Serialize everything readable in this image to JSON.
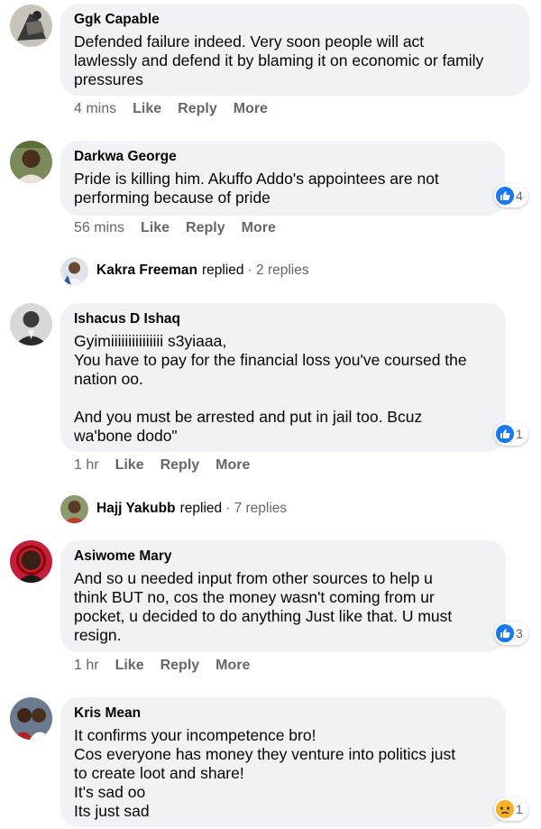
{
  "comments": [
    {
      "author": "Ggk Capable",
      "lines": [
        "Defended failure indeed. Very soon people will act",
        "lawlessly and defend it by blaming it on economic or family",
        "pressures"
      ],
      "time": "4 mins",
      "actions": [
        "Like",
        "Reply",
        "More"
      ]
    },
    {
      "author": "Darkwa George",
      "lines": [
        "Pride is killing him. Akuffo Addo's appointees are not",
        "performing because of pride"
      ],
      "time": "56 mins",
      "actions": [
        "Like",
        "Reply",
        "More"
      ],
      "reaction": {
        "icon": "like-icon",
        "count": "4"
      },
      "replied": {
        "name": "Kakra Freeman",
        "verb": "replied",
        "count": "· 2 replies"
      }
    },
    {
      "author": "Ishacus D Ishaq",
      "lines": [
        "Gyimiiiiiiiiiiiiiii s3yiaaa,",
        "You have to pay for the financial loss you've coursed the",
        "nation oo.",
        "",
        "And you must be arrested and put in jail too. Bcuz",
        "wa'bone dodo\""
      ],
      "time": "1 hr",
      "actions": [
        "Like",
        "Reply",
        "More"
      ],
      "reaction": {
        "icon": "like-icon",
        "count": "1"
      },
      "replied": {
        "name": "Hajj Yakubb",
        "verb": "replied",
        "count": "· 7 replies"
      }
    },
    {
      "author": "Asiwome Mary",
      "lines": [
        "And so u needed input from other sources to help u",
        "think BUT no, cos the money wasn't coming from ur",
        "pocket, u decided to do anything Just like that. U must",
        "resign."
      ],
      "time": "1 hr",
      "actions": [
        "Like",
        "Reply",
        "More"
      ],
      "reaction": {
        "icon": "like-icon",
        "count": "3"
      }
    },
    {
      "author": "Kris Mean",
      "lines": [
        "It confirms your incompetence bro!",
        "Cos everyone has money they venture into politics just",
        "to create loot and share!",
        "It's sad oo",
        "Its just sad"
      ],
      "reaction": {
        "icon": "sad-face-icon",
        "count": "1"
      }
    }
  ],
  "colors": {
    "bubble": "#f0f2f5",
    "text": "#050505",
    "meta": "#65676b",
    "like_blue": "#1877f2",
    "sad_yellow": "#f7b125"
  }
}
